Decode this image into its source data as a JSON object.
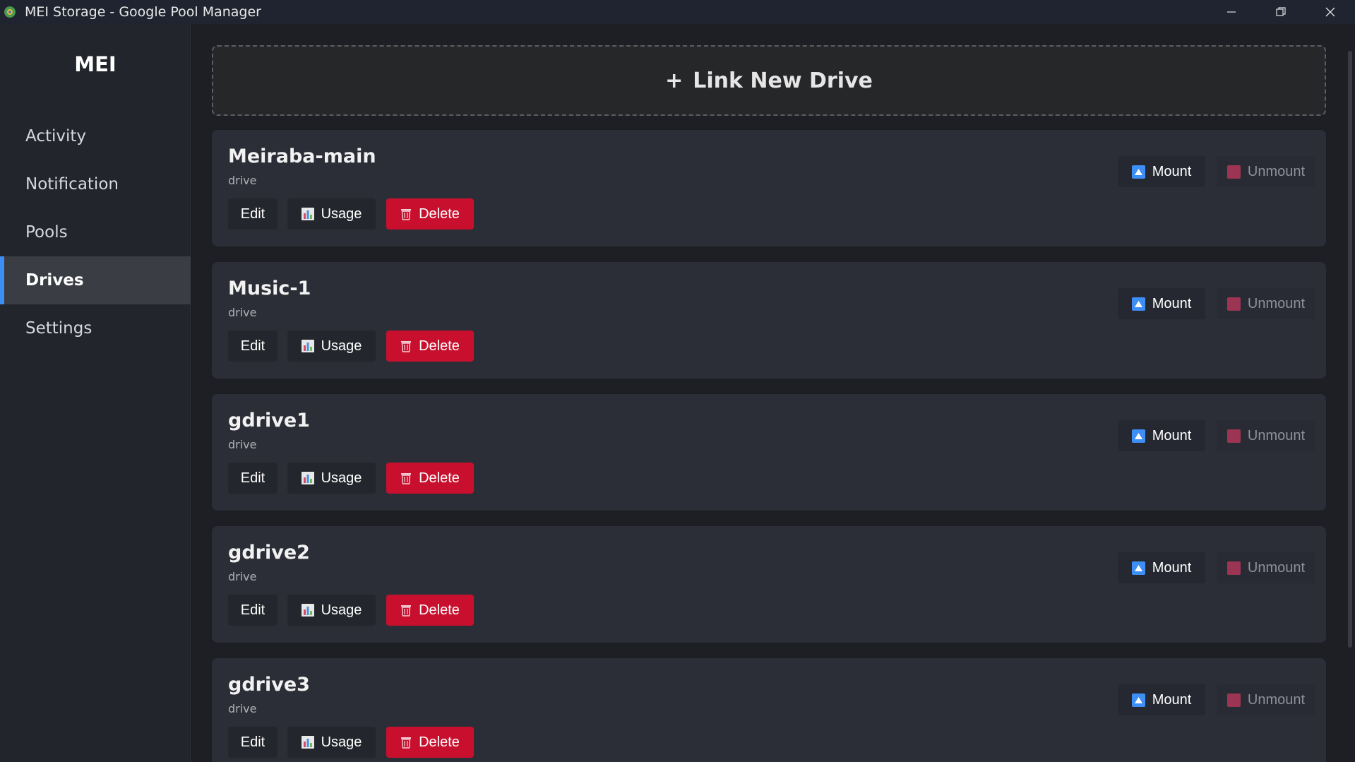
{
  "window": {
    "title": "MEI Storage - Google Pool Manager"
  },
  "sidebar": {
    "brand": "MEI",
    "items": [
      {
        "label": "Activity",
        "active": false
      },
      {
        "label": "Notification",
        "active": false
      },
      {
        "label": "Pools",
        "active": false
      },
      {
        "label": "Drives",
        "active": true
      },
      {
        "label": "Settings",
        "active": false
      }
    ]
  },
  "main": {
    "link_new_drive": {
      "plus": "+",
      "label": "Link New Drive"
    },
    "actions": {
      "edit": "Edit",
      "usage": "Usage",
      "delete": "Delete",
      "mount": "Mount",
      "unmount": "Unmount"
    },
    "drives": [
      {
        "name": "Meiraba-main",
        "type": "drive"
      },
      {
        "name": "Music-1",
        "type": "drive"
      },
      {
        "name": "gdrive1",
        "type": "drive"
      },
      {
        "name": "gdrive2",
        "type": "drive"
      },
      {
        "name": "gdrive3",
        "type": "drive"
      }
    ]
  },
  "colors": {
    "accent": "#3d8ef5",
    "danger": "#c8102e",
    "unmount": "#9c3553"
  }
}
